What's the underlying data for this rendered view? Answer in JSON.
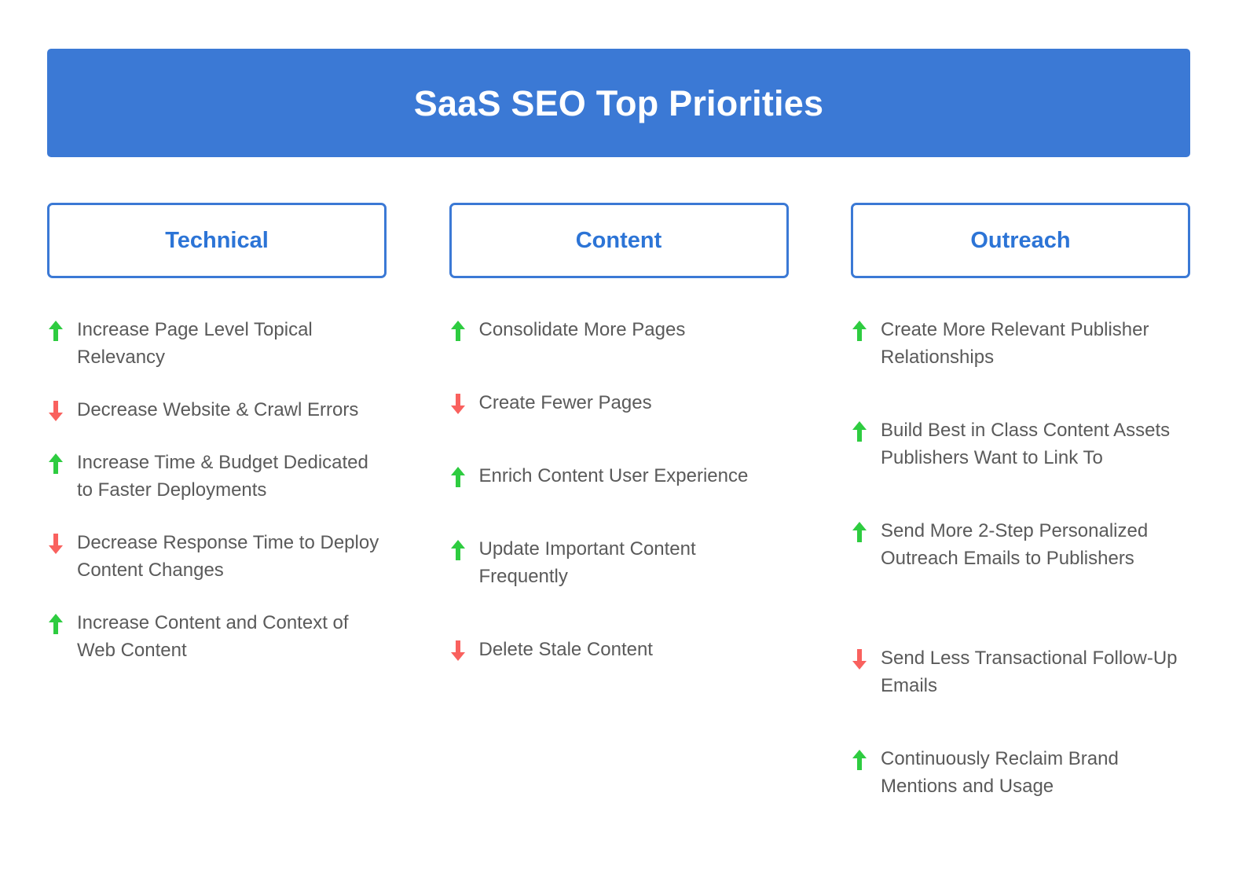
{
  "header": {
    "title": "SaaS SEO Top Priorities",
    "background_color": "#3B79D5",
    "text_color": "#FFFFFF"
  },
  "theme": {
    "accent_blue": "#3B79D5",
    "header_label_blue": "#2C74D6",
    "increase_green": "#2ECC40",
    "decrease_red": "#F9615E",
    "body_text_gray": "#5A5A5A",
    "page_background": "#FFFFFF"
  },
  "icons": {
    "increase": "arrow-up-icon",
    "decrease": "arrow-down-icon"
  },
  "columns": [
    {
      "id": "technical",
      "label": "Technical",
      "items": [
        {
          "direction": "up",
          "text": "Increase Page Level Topical Relevancy"
        },
        {
          "direction": "down",
          "text": "Decrease Website & Crawl Errors"
        },
        {
          "direction": "up",
          "text": "Increase Time & Budget Dedicated to Faster Deployments"
        },
        {
          "direction": "down",
          "text": "Decrease Response Time to Deploy Content Changes"
        },
        {
          "direction": "up",
          "text": "Increase Content and Context of Web Content"
        }
      ]
    },
    {
      "id": "content",
      "label": "Content",
      "items": [
        {
          "direction": "up",
          "text": "Consolidate More Pages"
        },
        {
          "direction": "down",
          "text": "Create Fewer Pages"
        },
        {
          "direction": "up",
          "text": "Enrich Content User Experience"
        },
        {
          "direction": "up",
          "text": "Update Important Content Frequently"
        },
        {
          "direction": "down",
          "text": "Delete Stale Content"
        }
      ]
    },
    {
      "id": "outreach",
      "label": "Outreach",
      "items": [
        {
          "direction": "up",
          "text": "Create More Relevant Publisher Relationships"
        },
        {
          "direction": "up",
          "text": "Build Best in Class Content Assets Publishers Want to Link To"
        },
        {
          "direction": "up",
          "text": "Send More 2-Step Personalized Outreach Emails to Publishers",
          "wide_gap": true
        },
        {
          "direction": "down",
          "text": "Send Less Transactional Follow-Up Emails"
        },
        {
          "direction": "up",
          "text": "Continuously Reclaim Brand Mentions and Usage"
        }
      ]
    }
  ]
}
